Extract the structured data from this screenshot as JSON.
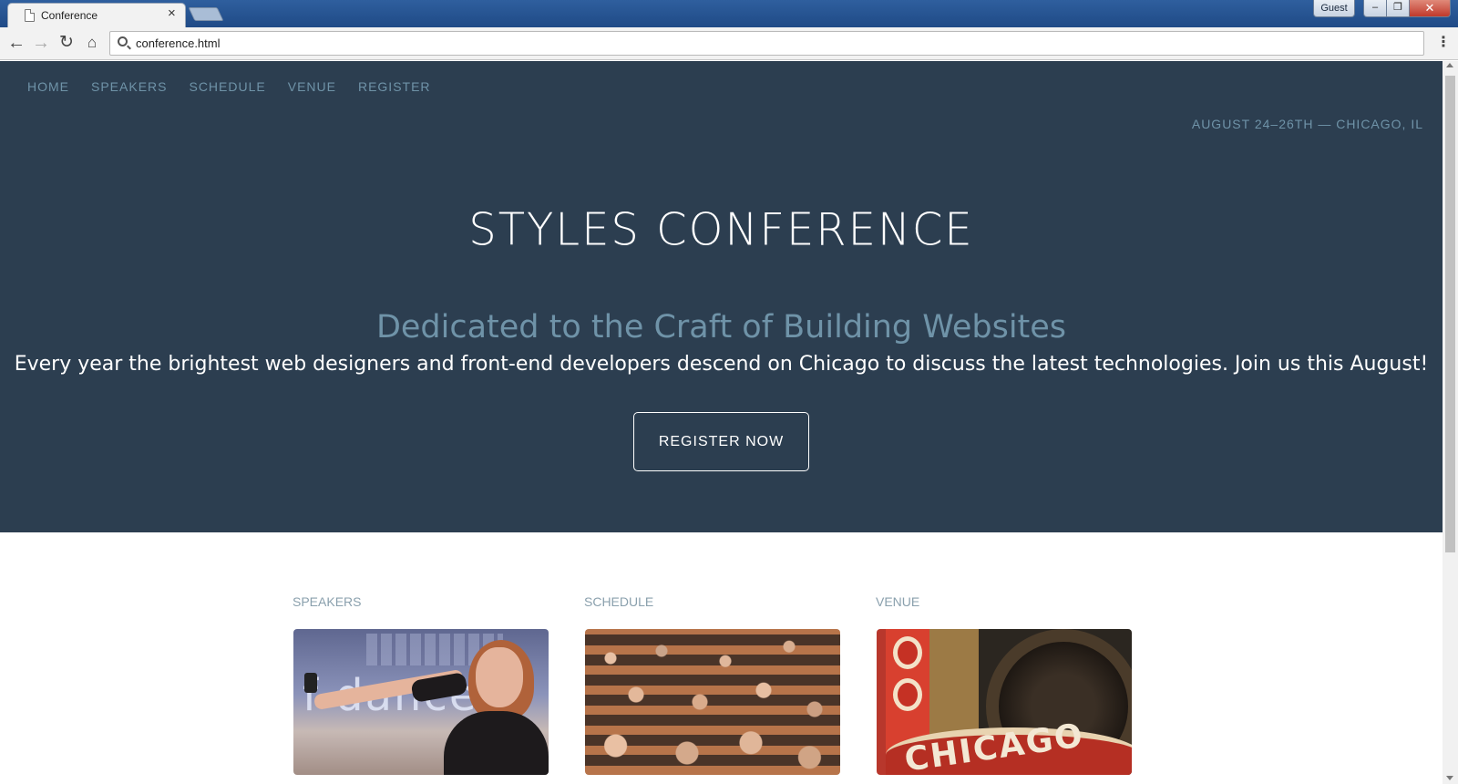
{
  "browser": {
    "tab_title": "Conference",
    "tab_close": "×",
    "profile_label": "Guest",
    "address": "conference.html",
    "window_min": "–",
    "window_max": "❐",
    "window_close": "✕",
    "menu": "⋮"
  },
  "nav": {
    "items": [
      {
        "label": "HOME"
      },
      {
        "label": "SPEAKERS"
      },
      {
        "label": "SCHEDULE"
      },
      {
        "label": "VENUE"
      },
      {
        "label": "REGISTER"
      }
    ],
    "event_date": "AUGUST 24–26TH — CHICAGO, IL"
  },
  "hero": {
    "title": "STYLES CONFERENCE",
    "subtitle": "Dedicated to the Craft of Building Websites",
    "lead": "Every year the brightest web designers and front-end developers descend on Chicago to discuss the latest technologies. Join us this August!",
    "cta_label": "REGISTER NOW"
  },
  "teasers": [
    {
      "heading": "SPEAKERS",
      "image": "speaker-photo",
      "screen_text": "f dance"
    },
    {
      "heading": "SCHEDULE",
      "image": "audience-photo"
    },
    {
      "heading": "VENUE",
      "image": "chicago-theatre-photo",
      "sign_text": "CHICAGO"
    }
  ],
  "colors": {
    "hero_bg": "#2c3e50",
    "nav_text": "#6f93a8",
    "heading_muted": "#8aa0ad"
  }
}
